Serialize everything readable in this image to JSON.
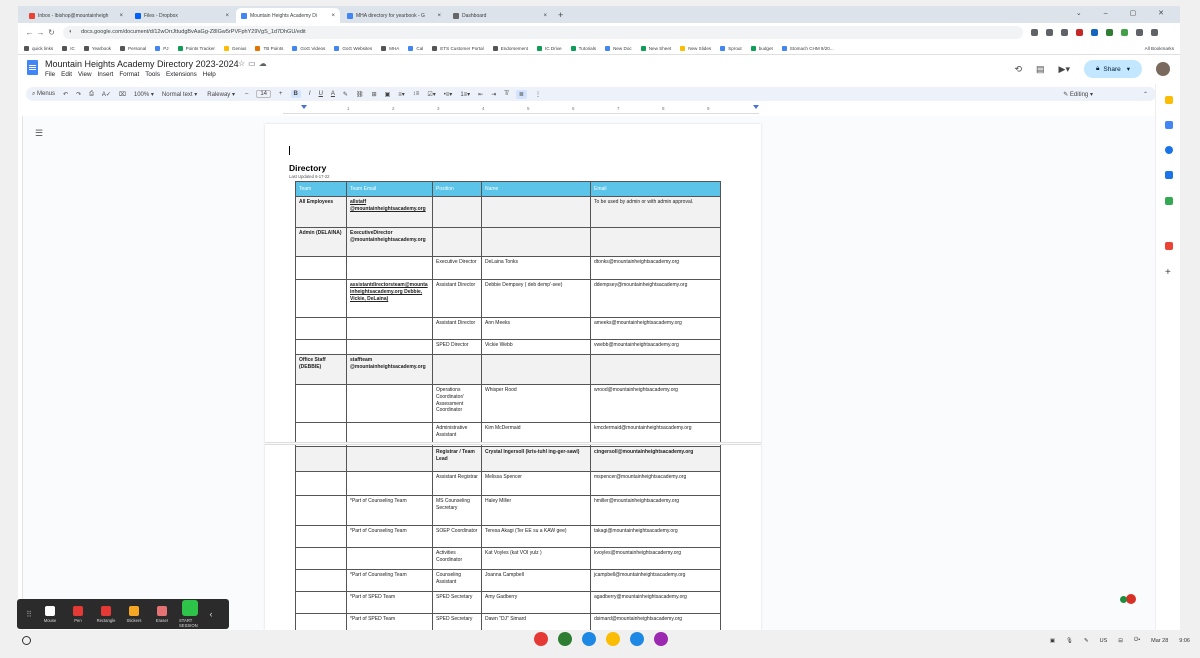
{
  "browser": {
    "tabs": [
      {
        "label": "Inbox - lbishop@mountainheigh",
        "color": "#ea4335",
        "active": false
      },
      {
        "label": "Files - Dropbox",
        "color": "#0061fe",
        "active": false
      },
      {
        "label": "Mountain Heights Academy Di",
        "color": "#4285f4",
        "active": true
      },
      {
        "label": "MHA directory for yearbook - G",
        "color": "#4285f4",
        "active": false
      },
      {
        "label": "Dashboard",
        "color": "#666666",
        "active": false
      }
    ],
    "url": "docs.google.com/document/d/12wOrrJttudgBvAaGg-Z8IGw5rPVFphY29VgS_1d7DhGU/edit",
    "bookmarks": [
      {
        "label": "quick links",
        "color": "#555555"
      },
      {
        "label": "IC",
        "color": "#555555"
      },
      {
        "label": "Yearbook",
        "color": "#555555"
      },
      {
        "label": "Personal",
        "color": "#555555"
      },
      {
        "label": "PJ",
        "color": "#4285f4"
      },
      {
        "label": "Points Tracker",
        "color": "#0f9d58"
      },
      {
        "label": "Genius",
        "color": "#fbbc04"
      },
      {
        "label": "TB Points",
        "color": "#e37400"
      },
      {
        "label": "GoG Videos",
        "color": "#4285f4"
      },
      {
        "label": "GoG Websites",
        "color": "#4285f4"
      },
      {
        "label": "MHA",
        "color": "#555555"
      },
      {
        "label": "Cal",
        "color": "#4285f4"
      },
      {
        "label": "ETS Customer Portal",
        "color": "#555555"
      },
      {
        "label": "Endorsement",
        "color": "#555555"
      },
      {
        "label": "IC Drive",
        "color": "#0f9d58"
      },
      {
        "label": "Tutorials",
        "color": "#0f9d58"
      },
      {
        "label": "New Doc",
        "color": "#4285f4"
      },
      {
        "label": "New Sheet",
        "color": "#0f9d58"
      },
      {
        "label": "New Slides",
        "color": "#fbbc04"
      },
      {
        "label": "Sprout",
        "color": "#4285f4"
      },
      {
        "label": "budget",
        "color": "#0f9d58"
      },
      {
        "label": "Stomach CHM 9/20...",
        "color": "#4285f4"
      }
    ],
    "all_bookmarks": "All Bookmarks"
  },
  "docs": {
    "title": "Mountain Heights Academy Directory 2023-2024",
    "menu": [
      "File",
      "Edit",
      "View",
      "Insert",
      "Format",
      "Tools",
      "Extensions",
      "Help"
    ],
    "share_label": "Share",
    "toolbar": {
      "menus": "Menus",
      "zoom": "100%",
      "style": "Normal text",
      "font": "Raleway",
      "font_size": "14",
      "bold": "B",
      "italic": "I",
      "underline": "U",
      "text_color": "A",
      "editing": "Editing"
    },
    "ruler_numbers": [
      "1",
      "2",
      "3",
      "4",
      "5",
      "6",
      "7",
      "8",
      "9"
    ]
  },
  "document": {
    "heading": "Directory",
    "updated": "Last Updated 6-17-22",
    "columns": [
      "Team",
      "Team Email",
      "Position",
      "Name",
      "Email"
    ],
    "rows": [
      {
        "team": "All Employees",
        "team_email": "allstaff @mountainheightsacademy.org",
        "position": "",
        "name": "",
        "email": "To be used by admin or with admin approval.",
        "shade": true,
        "h": 31
      },
      {
        "team": "Admin (DELAINA)",
        "team_email": "ExecutiveDirector @mountainheightsacademy.org",
        "position": "",
        "name": "",
        "email": "",
        "shade": true,
        "h": 29
      },
      {
        "team": "",
        "team_email": "",
        "position": "Executive Director",
        "name": "DeLaina Tonks",
        "email": "dtonks@mountainheightsacademy.org",
        "shade": false,
        "h": 23
      },
      {
        "team": "",
        "team_email": "assistantdirectorsteam@mountainheightsacademy.org Debbie, Vickie, DeLaina)",
        "position": "Assistant Director",
        "name": "Debbie Dempsey ( deb demp'-see)",
        "email": "ddempsey@mountainheightsacademy.org",
        "shade": false,
        "h": 38
      },
      {
        "team": "",
        "team_email": "",
        "position": "Assistant Director",
        "name": "Ann Meeks",
        "email": "ameeks@mountainheightsacademy.org",
        "shade": false,
        "h": 22
      },
      {
        "team": "",
        "team_email": "",
        "position": "SPED Director",
        "name": "Vickie Webb",
        "email": "vwebb@mountainheightsacademy.org",
        "shade": false,
        "h": 15
      },
      {
        "team": "Office Staff (DEBBIE)",
        "team_email": "staffteam @mountainheightsacademy.org",
        "position": "",
        "name": "",
        "email": "",
        "shade": true,
        "h": 30
      },
      {
        "team": "",
        "team_email": "",
        "position": "Operations Coordinator/ Assessment Coordinator",
        "name": "Whisper Rood",
        "email": "wrood@mountainheightsacademy.org",
        "shade": false,
        "h": 38
      },
      {
        "team": "",
        "team_email": "",
        "position": "Administrative Assistant",
        "name": "Kim McDermaid",
        "email": "kmcdermaid@mountainheightsacademy.org",
        "shade": false,
        "h": 24
      },
      {
        "team": "",
        "team_email": "",
        "position": "Registrar / Team Lead",
        "name": "Crystal Ingersoll (kris-tuhl ing-ger-sawl)",
        "email": "cingersoll@mountainheightsacademy.org",
        "shade": true,
        "h": 25,
        "bold": true
      },
      {
        "team": "",
        "team_email": "",
        "position": "Assistant Registrar",
        "name": "Melissa Spencer",
        "email": "mspencer@mountainheightsacademy.org",
        "shade": false,
        "h": 24
      },
      {
        "team": "",
        "team_email": "*Part of Counseling Team",
        "position": "MS Counseling Secretary",
        "name": "Haley Miller",
        "email": "hmiller@mountainheightsacademy.org",
        "shade": false,
        "h": 30
      },
      {
        "team": "",
        "team_email": "*Part of Counseling Team",
        "position": "SOEP Coordinator",
        "name": "Teresa Akagi (Ter EE su a KAW gee)",
        "email": "takagi@mountainheightsacademy.org",
        "shade": false,
        "h": 22
      },
      {
        "team": "",
        "team_email": "",
        "position": "Activities Coordinator",
        "name": "Kat Voyles (kat VOI yulz )",
        "email": "kvoyles@mountainheightsacademy.org",
        "shade": false,
        "h": 22
      },
      {
        "team": "",
        "team_email": "*Part of Counseling Team",
        "position": "Counseling Assistant",
        "name": "Joanna Campbell",
        "email": "jcampbell@mountainheightsacademy.org",
        "shade": false,
        "h": 22
      },
      {
        "team": "",
        "team_email": "*Part of SPED Team",
        "position": "SPED Secretary",
        "name": "Amy Gadberry",
        "email": "agadberry@mountainheightsacademy.org",
        "shade": false,
        "h": 22
      },
      {
        "team": "",
        "team_email": "*Part of SPED Team",
        "position": "SPED Secretary",
        "name": "Dawn \"DJ\" Simard",
        "email": "dsimard@mountainheightsacademy.org",
        "shade": false,
        "h": 22
      }
    ]
  },
  "annotation_toolbar": [
    {
      "label": "Mouse",
      "color": "#ffffff"
    },
    {
      "label": "Pen",
      "color": "#e53935"
    },
    {
      "label": "Rectangle",
      "color": "#e53935"
    },
    {
      "label": "Stickers",
      "color": "#f5a623"
    },
    {
      "label": "Eraser",
      "color": "#e57373"
    },
    {
      "label": "START SESSION",
      "color": "#2ec44a"
    }
  ],
  "taskbar": {
    "apps": [
      {
        "name": "screen-recorder",
        "color": "#e53935"
      },
      {
        "name": "classroom",
        "color": "#2e7d32"
      },
      {
        "name": "files",
        "color": "#1e88e5"
      },
      {
        "name": "chrome",
        "color": "#fbbc04"
      },
      {
        "name": "folder",
        "color": "#1e88e5"
      },
      {
        "name": "app",
        "color": "#9c27b0"
      }
    ],
    "locale": "US",
    "date": "Mar 28",
    "time": "9:06"
  }
}
